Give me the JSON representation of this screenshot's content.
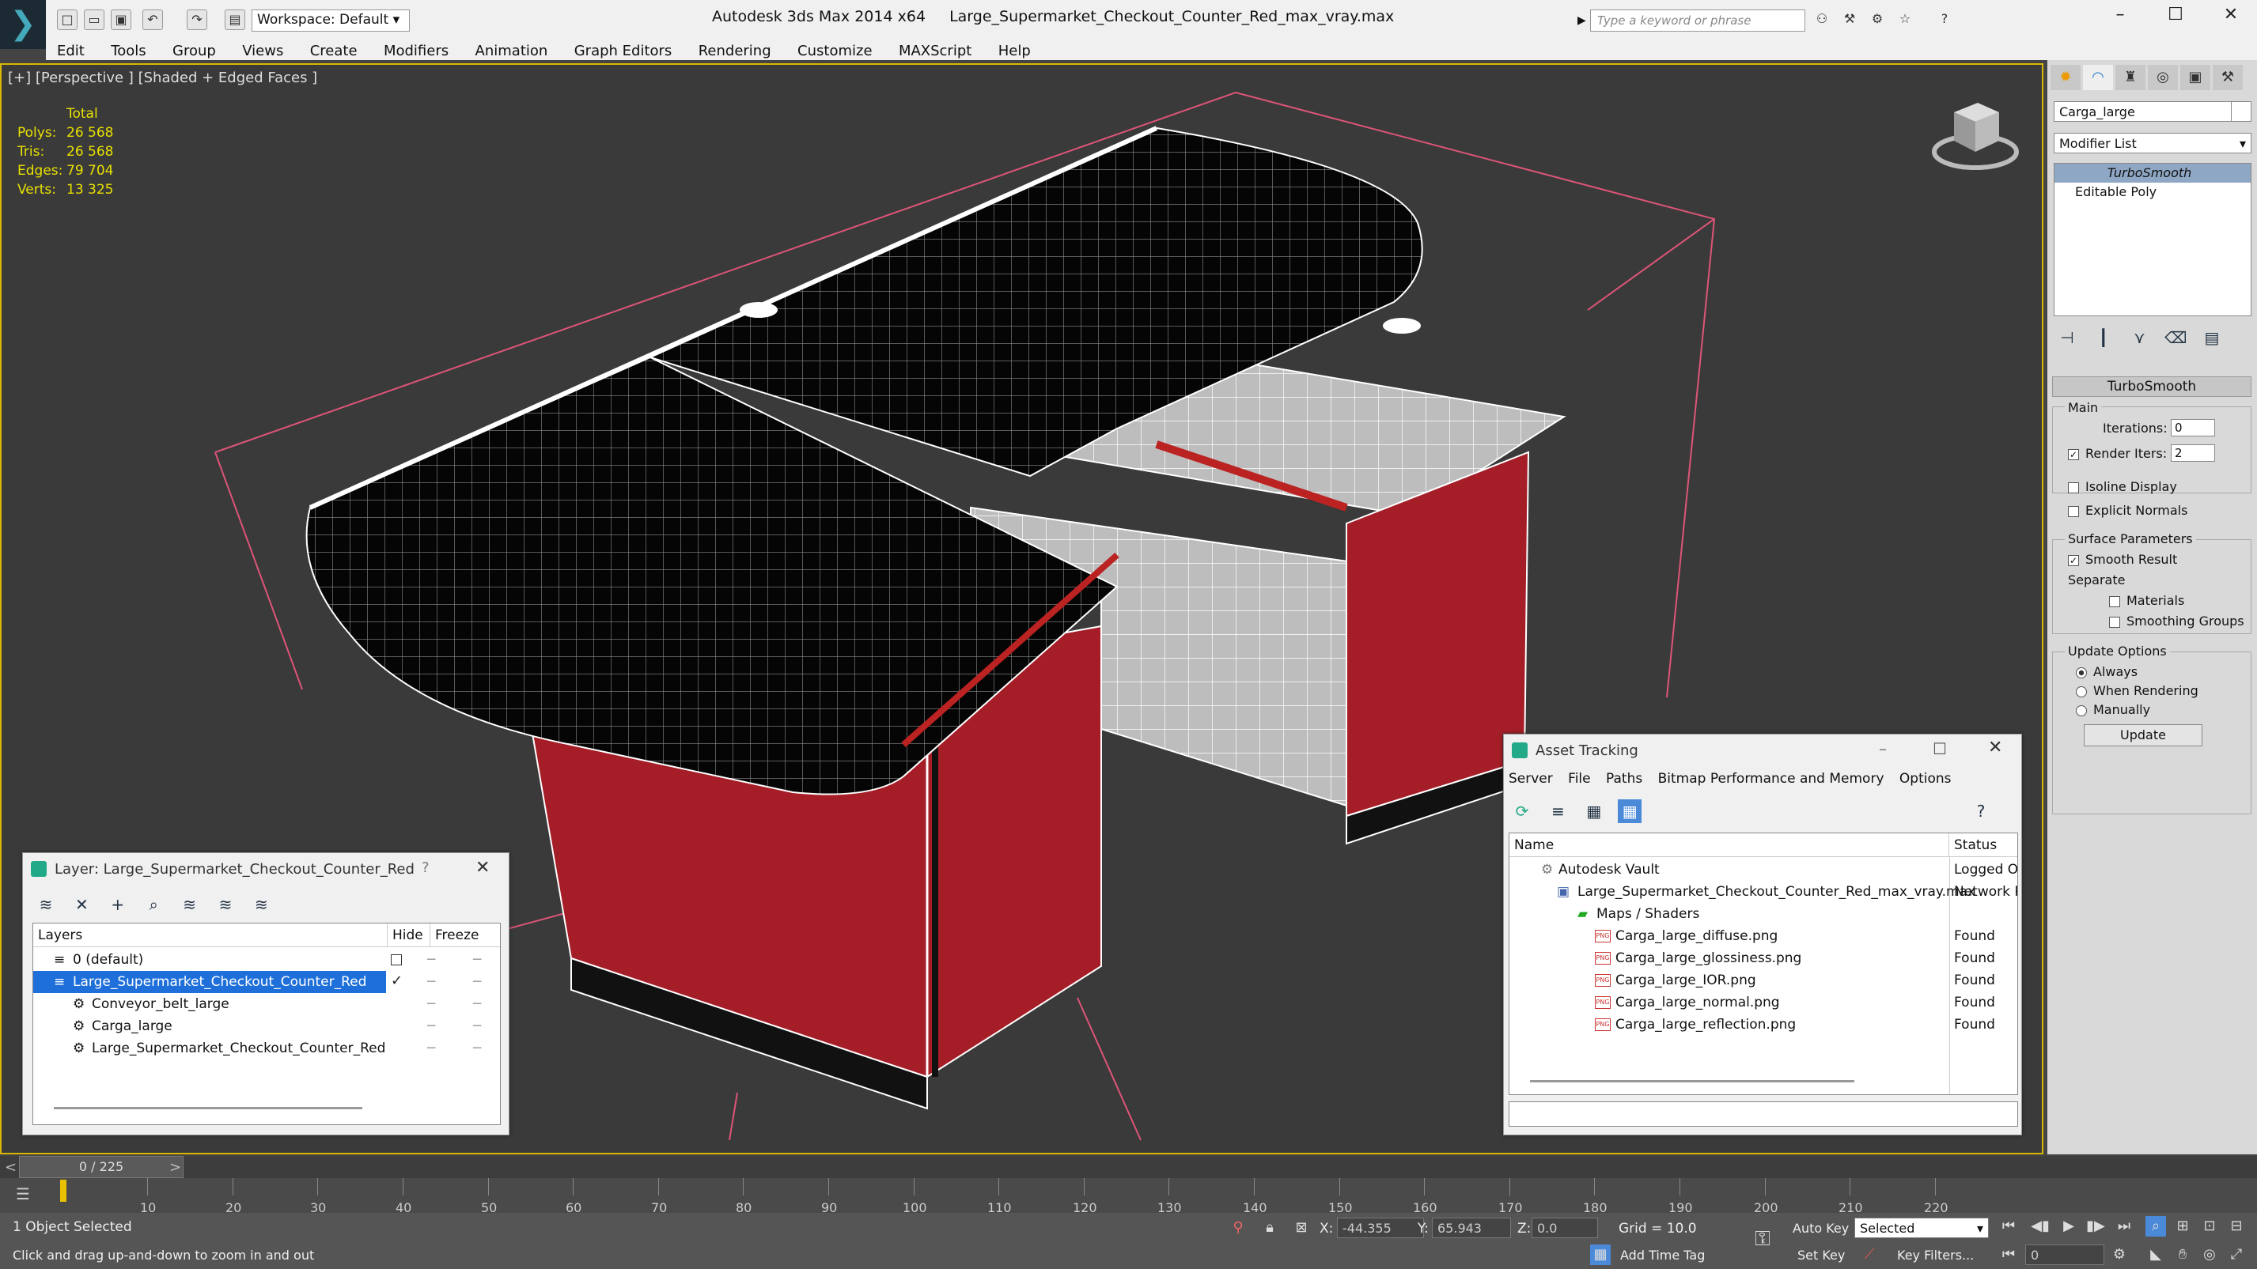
{
  "titlebar": {
    "app": "Autodesk 3ds Max  2014 x64",
    "file": "Large_Supermarket_Checkout_Counter_Red_max_vray.max",
    "workspace": "Workspace: Default",
    "search_placeholder": "Type a keyword or phrase"
  },
  "menu": [
    "Edit",
    "Tools",
    "Group",
    "Views",
    "Create",
    "Modifiers",
    "Animation",
    "Graph Editors",
    "Rendering",
    "Customize",
    "MAXScript",
    "Help"
  ],
  "viewport": {
    "label": "[+] [Perspective ] [Shaded + Edged Faces ]",
    "stats_header": "Total",
    "stats": [
      {
        "label": "Polys:",
        "value": "26 568"
      },
      {
        "label": "Tris:",
        "value": "26 568"
      },
      {
        "label": "Edges:",
        "value": "79 704"
      },
      {
        "label": "Verts:",
        "value": "13 325"
      }
    ]
  },
  "command_panel": {
    "object_name": "Carga_large",
    "modifier_list": "Modifier List",
    "stack": [
      "TurboSmooth",
      "Editable Poly"
    ],
    "rollout_title": "TurboSmooth",
    "main_label": "Main",
    "iterations_label": "Iterations:",
    "iterations": "0",
    "render_iters_label": "Render Iters:",
    "render_iters": "2",
    "isoline": "Isoline Display",
    "explicit": "Explicit Normals",
    "surface_params": "Surface Parameters",
    "smooth_result": "Smooth Result",
    "separate": "Separate",
    "materials": "Materials",
    "smoothing_groups": "Smoothing Groups",
    "update_options": "Update Options",
    "always": "Always",
    "when_rendering": "When Rendering",
    "manually": "Manually",
    "update_btn": "Update"
  },
  "layer_panel": {
    "title": "Layer: Large_Supermarket_Checkout_Counter_Red",
    "help": "?",
    "col_layers": "Layers",
    "col_hide": "Hide",
    "col_freeze": "Freeze",
    "rows": [
      {
        "name": "0 (default)"
      },
      {
        "name": "Large_Supermarket_Checkout_Counter_Red"
      },
      {
        "name": "Conveyor_belt_large"
      },
      {
        "name": "Carga_large"
      },
      {
        "name": "Large_Supermarket_Checkout_Counter_Red"
      }
    ]
  },
  "asset_panel": {
    "title": "Asset Tracking",
    "menu": [
      "Server",
      "File",
      "Paths",
      "Bitmap Performance and Memory",
      "Options"
    ],
    "col_name": "Name",
    "col_status": "Status",
    "rows": [
      {
        "name": "Autodesk Vault",
        "status": "Logged O"
      },
      {
        "name": "Large_Supermarket_Checkout_Counter_Red_max_vray.max",
        "status": "Network P"
      },
      {
        "name": "Maps / Shaders",
        "status": ""
      },
      {
        "name": "Carga_large_diffuse.png",
        "status": "Found"
      },
      {
        "name": "Carga_large_glossiness.png",
        "status": "Found"
      },
      {
        "name": "Carga_large_IOR.png",
        "status": "Found"
      },
      {
        "name": "Carga_large_normal.png",
        "status": "Found"
      },
      {
        "name": "Carga_large_reflection.png",
        "status": "Found"
      }
    ]
  },
  "timeline": {
    "frame": "0 / 225",
    "ticks": [
      "10",
      "20",
      "30",
      "40",
      "50",
      "60",
      "70",
      "80",
      "90",
      "100",
      "110",
      "120",
      "130",
      "140",
      "150",
      "160",
      "170",
      "180",
      "190",
      "200",
      "210",
      "220"
    ]
  },
  "status": {
    "selected": "1 Object Selected",
    "hint": "Click and drag up-and-down to zoom in and out",
    "x_label": "X:",
    "x": "-44.355",
    "y_label": "Y:",
    "y": "65.943",
    "z_label": "Z:",
    "z": "0.0",
    "grid": "Grid = 10.0",
    "auto_key": "Auto Key",
    "selected_dropdown": "Selected",
    "set_key": "Set Key",
    "key_filters": "Key Filters...",
    "add_time_tag": "Add Time Tag",
    "frame_field": "0"
  }
}
